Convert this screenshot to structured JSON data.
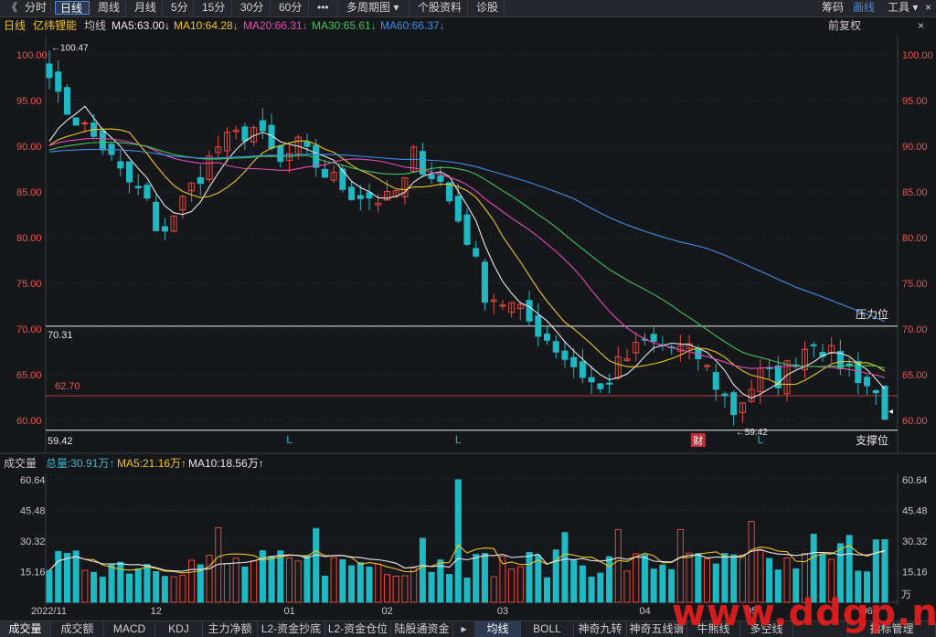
{
  "toolbar": {
    "back_icon": "《",
    "tabs": [
      "分时",
      "日线",
      "周线",
      "月线",
      "5分",
      "15分",
      "30分",
      "60分",
      "•••",
      "多周期图 ▾",
      "个股资料",
      "诊股"
    ],
    "active_tab": "日线",
    "right": [
      "筹码",
      "画线",
      "工具 ▾"
    ],
    "close_icon": "×"
  },
  "infobar": {
    "period": "日线",
    "stock_name": "亿纬锂能",
    "avg_label": "均线",
    "ma": [
      {
        "text": "MA5:63.00↓",
        "color": "#e8e8e8"
      },
      {
        "text": "MA10:64.28↓",
        "color": "#f0c419"
      },
      {
        "text": "MA20:66.31↓",
        "color": "#e24bb4"
      },
      {
        "text": "MA30:65.61↓",
        "color": "#3fc25a"
      },
      {
        "text": "MA60:66.37↓",
        "color": "#3b8ee8"
      }
    ],
    "right": "前复权",
    "right_icon": "×"
  },
  "volbar": {
    "label": "成交量",
    "items": [
      {
        "text": "总量:30.91万↑",
        "color": "#3fb4c8"
      },
      {
        "text": "MA5:21.16万↑",
        "color": "#f0c419"
      },
      {
        "text": "MA10:18.56万↑",
        "color": "#e8e8e8"
      }
    ]
  },
  "chart_data": [
    {
      "type": "candlestick",
      "title": "亿纬锂能 日线",
      "y_ticks": [
        "100.00",
        "95.00",
        "90.00",
        "85.00",
        "80.00",
        "75.00",
        "70.00",
        "65.00",
        "60.00"
      ],
      "ylim": [
        59.42,
        100.47
      ],
      "price_high": 100.47,
      "price_low": 59.42,
      "high_label": "←100.47",
      "low_label": "←59.42",
      "resistance": {
        "value": 70.31,
        "label": "压力位",
        "value_label": "70.31"
      },
      "support": {
        "value": 59.42,
        "label": "支撑位",
        "value_label": "59.42"
      },
      "red_line": {
        "value": 62.7,
        "label": "62.70"
      },
      "markers": [
        {
          "text": "L",
          "day": 27
        },
        {
          "text": "L",
          "day": 46
        },
        {
          "text": "L",
          "day": 80
        }
      ],
      "event_badge": {
        "text": "财",
        "day": 73
      },
      "series": [
        {
          "name": "MA5",
          "color": "#e8e8e8"
        },
        {
          "name": "MA10",
          "color": "#f0c419"
        },
        {
          "name": "MA20",
          "color": "#e24bb4"
        },
        {
          "name": "MA30",
          "color": "#3fc25a"
        },
        {
          "name": "MA60",
          "color": "#3b8ee8"
        }
      ],
      "colors": {
        "up": "#e8483b",
        "down": "#1fb8c3"
      }
    },
    {
      "type": "bar",
      "title": "成交量",
      "unit": "万",
      "y_ticks": [
        "60.64",
        "45.48",
        "30.32",
        "15.16"
      ],
      "ylim": [
        0,
        60.64
      ],
      "x_ticks": [
        {
          "label": "2022/11",
          "day": 0
        },
        {
          "label": "12",
          "day": 12
        },
        {
          "label": "01",
          "day": 27
        },
        {
          "label": "02",
          "day": 38
        },
        {
          "label": "03",
          "day": 51
        },
        {
          "label": "04",
          "day": 67
        },
        {
          "label": "05",
          "day": 79
        },
        {
          "label": "06",
          "day": 92
        }
      ],
      "series": [
        {
          "name": "MA5",
          "color": "#f0c419"
        },
        {
          "name": "MA10",
          "color": "#e8e8e8"
        }
      ]
    }
  ],
  "bottom_tabs": [
    "成交量",
    "成交额",
    "MACD",
    "KDJ",
    "主力净额",
    "L2-资金抄底",
    "L2-资金仓位",
    "陆股通资金",
    "▸",
    "均线",
    "BOLL",
    "神奇九转",
    "神奇五线谱",
    "牛熊线",
    "多空线",
    "",
    "指标管理"
  ],
  "watermark": "www.ddgp.net"
}
